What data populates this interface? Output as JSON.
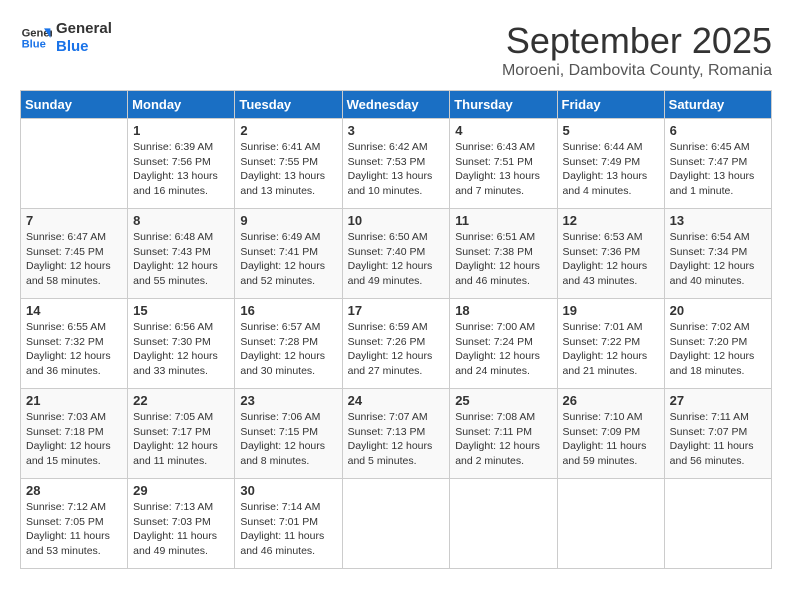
{
  "header": {
    "logo_line1": "General",
    "logo_line2": "Blue",
    "month": "September 2025",
    "location": "Moroeni, Dambovita County, Romania"
  },
  "days_of_week": [
    "Sunday",
    "Monday",
    "Tuesday",
    "Wednesday",
    "Thursday",
    "Friday",
    "Saturday"
  ],
  "weeks": [
    [
      {
        "day": "",
        "info": ""
      },
      {
        "day": "1",
        "info": "Sunrise: 6:39 AM\nSunset: 7:56 PM\nDaylight: 13 hours\nand 16 minutes."
      },
      {
        "day": "2",
        "info": "Sunrise: 6:41 AM\nSunset: 7:55 PM\nDaylight: 13 hours\nand 13 minutes."
      },
      {
        "day": "3",
        "info": "Sunrise: 6:42 AM\nSunset: 7:53 PM\nDaylight: 13 hours\nand 10 minutes."
      },
      {
        "day": "4",
        "info": "Sunrise: 6:43 AM\nSunset: 7:51 PM\nDaylight: 13 hours\nand 7 minutes."
      },
      {
        "day": "5",
        "info": "Sunrise: 6:44 AM\nSunset: 7:49 PM\nDaylight: 13 hours\nand 4 minutes."
      },
      {
        "day": "6",
        "info": "Sunrise: 6:45 AM\nSunset: 7:47 PM\nDaylight: 13 hours\nand 1 minute."
      }
    ],
    [
      {
        "day": "7",
        "info": "Sunrise: 6:47 AM\nSunset: 7:45 PM\nDaylight: 12 hours\nand 58 minutes."
      },
      {
        "day": "8",
        "info": "Sunrise: 6:48 AM\nSunset: 7:43 PM\nDaylight: 12 hours\nand 55 minutes."
      },
      {
        "day": "9",
        "info": "Sunrise: 6:49 AM\nSunset: 7:41 PM\nDaylight: 12 hours\nand 52 minutes."
      },
      {
        "day": "10",
        "info": "Sunrise: 6:50 AM\nSunset: 7:40 PM\nDaylight: 12 hours\nand 49 minutes."
      },
      {
        "day": "11",
        "info": "Sunrise: 6:51 AM\nSunset: 7:38 PM\nDaylight: 12 hours\nand 46 minutes."
      },
      {
        "day": "12",
        "info": "Sunrise: 6:53 AM\nSunset: 7:36 PM\nDaylight: 12 hours\nand 43 minutes."
      },
      {
        "day": "13",
        "info": "Sunrise: 6:54 AM\nSunset: 7:34 PM\nDaylight: 12 hours\nand 40 minutes."
      }
    ],
    [
      {
        "day": "14",
        "info": "Sunrise: 6:55 AM\nSunset: 7:32 PM\nDaylight: 12 hours\nand 36 minutes."
      },
      {
        "day": "15",
        "info": "Sunrise: 6:56 AM\nSunset: 7:30 PM\nDaylight: 12 hours\nand 33 minutes."
      },
      {
        "day": "16",
        "info": "Sunrise: 6:57 AM\nSunset: 7:28 PM\nDaylight: 12 hours\nand 30 minutes."
      },
      {
        "day": "17",
        "info": "Sunrise: 6:59 AM\nSunset: 7:26 PM\nDaylight: 12 hours\nand 27 minutes."
      },
      {
        "day": "18",
        "info": "Sunrise: 7:00 AM\nSunset: 7:24 PM\nDaylight: 12 hours\nand 24 minutes."
      },
      {
        "day": "19",
        "info": "Sunrise: 7:01 AM\nSunset: 7:22 PM\nDaylight: 12 hours\nand 21 minutes."
      },
      {
        "day": "20",
        "info": "Sunrise: 7:02 AM\nSunset: 7:20 PM\nDaylight: 12 hours\nand 18 minutes."
      }
    ],
    [
      {
        "day": "21",
        "info": "Sunrise: 7:03 AM\nSunset: 7:18 PM\nDaylight: 12 hours\nand 15 minutes."
      },
      {
        "day": "22",
        "info": "Sunrise: 7:05 AM\nSunset: 7:17 PM\nDaylight: 12 hours\nand 11 minutes."
      },
      {
        "day": "23",
        "info": "Sunrise: 7:06 AM\nSunset: 7:15 PM\nDaylight: 12 hours\nand 8 minutes."
      },
      {
        "day": "24",
        "info": "Sunrise: 7:07 AM\nSunset: 7:13 PM\nDaylight: 12 hours\nand 5 minutes."
      },
      {
        "day": "25",
        "info": "Sunrise: 7:08 AM\nSunset: 7:11 PM\nDaylight: 12 hours\nand 2 minutes."
      },
      {
        "day": "26",
        "info": "Sunrise: 7:10 AM\nSunset: 7:09 PM\nDaylight: 11 hours\nand 59 minutes."
      },
      {
        "day": "27",
        "info": "Sunrise: 7:11 AM\nSunset: 7:07 PM\nDaylight: 11 hours\nand 56 minutes."
      }
    ],
    [
      {
        "day": "28",
        "info": "Sunrise: 7:12 AM\nSunset: 7:05 PM\nDaylight: 11 hours\nand 53 minutes."
      },
      {
        "day": "29",
        "info": "Sunrise: 7:13 AM\nSunset: 7:03 PM\nDaylight: 11 hours\nand 49 minutes."
      },
      {
        "day": "30",
        "info": "Sunrise: 7:14 AM\nSunset: 7:01 PM\nDaylight: 11 hours\nand 46 minutes."
      },
      {
        "day": "",
        "info": ""
      },
      {
        "day": "",
        "info": ""
      },
      {
        "day": "",
        "info": ""
      },
      {
        "day": "",
        "info": ""
      }
    ]
  ]
}
